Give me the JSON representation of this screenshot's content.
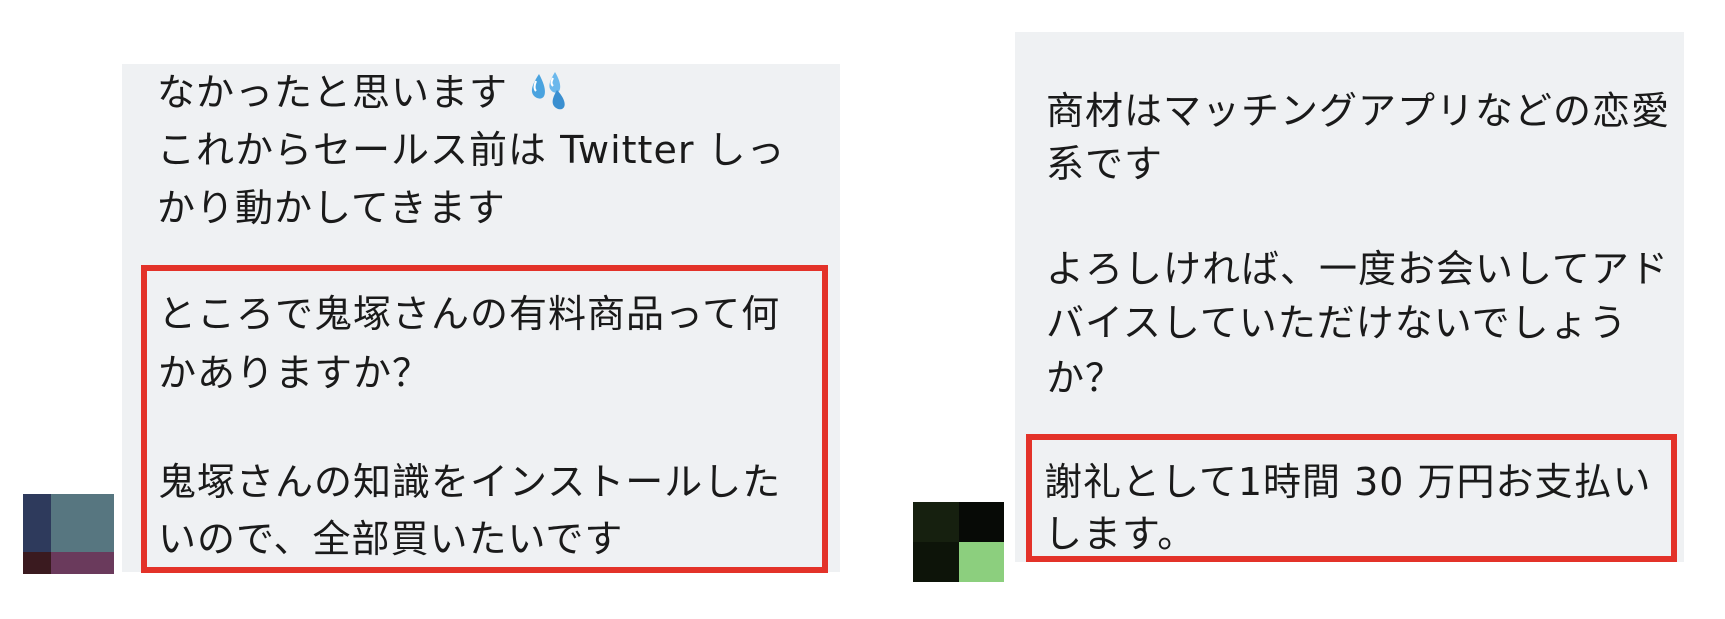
{
  "left_chat": {
    "lines": [
      "なかったと思います",
      "これからセールス前は Twitter しっ",
      "かり動かしてきます",
      "ところで鬼塚さんの有料商品って何",
      "かありますか？",
      "鬼塚さんの知識をインストールした",
      "いので、全部買いたいです"
    ],
    "emoji_icon": "sweat-droplets-icon",
    "highlight_color": "#e33229",
    "bubble_color": "#eff1f3"
  },
  "right_chat": {
    "lines": [
      "商材はマッチングアプリなどの恋愛",
      "系です",
      "よろしければ、一度お会いしてアド",
      "バイスしていただけないでしょう",
      "か？",
      "謝礼として1時間 30 万円お支払い",
      "します。"
    ],
    "highlight_color": "#e33229",
    "bubble_color": "#eff1f3"
  }
}
